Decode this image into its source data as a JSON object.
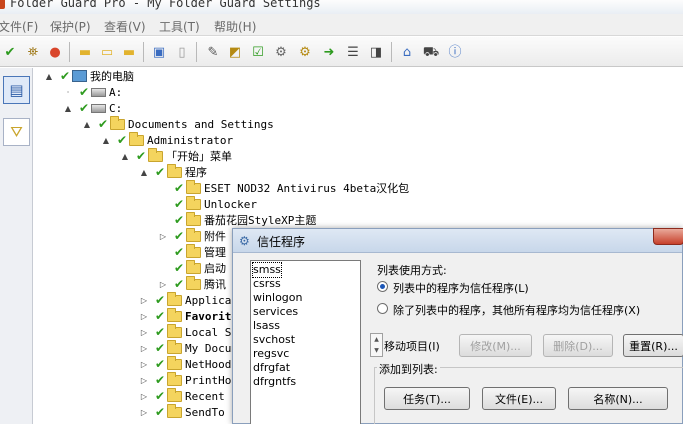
{
  "window": {
    "title": "Folder Guard Pro - My Folder Guard Settings"
  },
  "menu": [
    "文件(F)",
    "保护(P)",
    "查看(V)",
    "工具(T)",
    "帮助(H)"
  ],
  "toolbar": {
    "icons": [
      "check-icon",
      "binoculars-icon",
      "stop-icon",
      "folder-icon",
      "folder-open-icon",
      "folder-new-icon",
      "page-add-icon",
      "page-icon",
      "wand-icon",
      "lock-file-icon",
      "check-folder-icon",
      "gear-shield-icon",
      "gears-icon",
      "arrow-key-icon",
      "list-icon",
      "hide-icon",
      "home-icon",
      "cart-icon",
      "info-icon"
    ]
  },
  "sidebar": {
    "icons": [
      "computer-view-icon",
      "filter-icon"
    ]
  },
  "tree": [
    {
      "label": "我的电脑",
      "kind": "pc",
      "toggle": "▲"
    },
    {
      "label": "A:",
      "kind": "drive",
      "toggle": "·"
    },
    {
      "label": "C:",
      "kind": "drive",
      "toggle": "▲"
    },
    {
      "label": "Documents and Settings",
      "kind": "folder",
      "toggle": "▲"
    },
    {
      "label": "Administrator",
      "kind": "folder",
      "toggle": "▲"
    },
    {
      "label": "「开始」菜单",
      "kind": "folder",
      "toggle": "▲"
    },
    {
      "label": "程序",
      "kind": "folder",
      "toggle": "▲"
    },
    {
      "label": "ESET NOD32 Antivirus 4beta汉化包",
      "kind": "folder",
      "toggle": ""
    },
    {
      "label": "Unlocker",
      "kind": "folder",
      "toggle": ""
    },
    {
      "label": "番茄花园StyleXP主题",
      "kind": "folder",
      "toggle": ""
    },
    {
      "label": "附件",
      "kind": "folder",
      "toggle": "▷"
    },
    {
      "label": "管理",
      "kind": "folder",
      "toggle": ""
    },
    {
      "label": "启动",
      "kind": "folder",
      "toggle": ""
    },
    {
      "label": "腾讯",
      "kind": "folder",
      "toggle": "▷"
    },
    {
      "label": "Applications",
      "kind": "folder",
      "toggle": "▷"
    },
    {
      "label": "Favorites",
      "kind": "folder",
      "toggle": "▷",
      "bold": true
    },
    {
      "label": "Local Settings",
      "kind": "folder",
      "toggle": "▷"
    },
    {
      "label": "My Documents",
      "kind": "folder",
      "toggle": "▷"
    },
    {
      "label": "NetHood",
      "kind": "folder",
      "toggle": "▷"
    },
    {
      "label": "PrintHood",
      "kind": "folder",
      "toggle": "▷"
    },
    {
      "label": "Recent",
      "kind": "folder",
      "toggle": "▷"
    },
    {
      "label": "SendTo",
      "kind": "folder",
      "toggle": "▷"
    }
  ],
  "dialog": {
    "title": "信任程序",
    "programs": [
      "smss",
      "csrss",
      "winlogon",
      "services",
      "lsass",
      "svchost",
      "regsvc",
      "dfrgfat",
      "dfrgntfs"
    ],
    "list_usage_label": "列表使用方式:",
    "option1": "列表中的程序为信任程序(L)",
    "option2": "除了列表中的程序，其他所有程序均为信任程序(X)",
    "move_label": "移动项目(I)",
    "modify_button": "修改(M)...",
    "delete_button": "删除(D)...",
    "reset_button": "重置(R)...",
    "add_to_list_label": "添加到列表:",
    "task_button": "任务(T)...",
    "file_button": "文件(E)...",
    "name_button": "名称(N)..."
  }
}
